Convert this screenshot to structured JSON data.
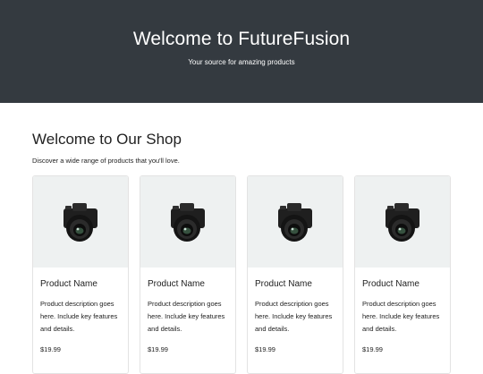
{
  "hero": {
    "title": "Welcome to FutureFusion",
    "subtitle": "Your source for amazing products"
  },
  "shop": {
    "title": "Welcome to Our Shop",
    "subtitle": "Discover a wide range of products that you'll love."
  },
  "products": [
    {
      "name": "Product Name",
      "description": "Product description goes here. Include key features and details.",
      "price": "$19.99",
      "image_icon": "camera-icon"
    },
    {
      "name": "Product Name",
      "description": "Product description goes here. Include key features and details.",
      "price": "$19.99",
      "image_icon": "camera-icon"
    },
    {
      "name": "Product Name",
      "description": "Product description goes here. Include key features and details.",
      "price": "$19.99",
      "image_icon": "camera-icon"
    },
    {
      "name": "Product Name",
      "description": "Product description goes here. Include key features and details.",
      "price": "$19.99",
      "image_icon": "camera-icon"
    }
  ],
  "colors": {
    "hero_bg": "#343a40",
    "card_image_bg": "#eef1f1",
    "card_border": "#e3e3e3"
  }
}
